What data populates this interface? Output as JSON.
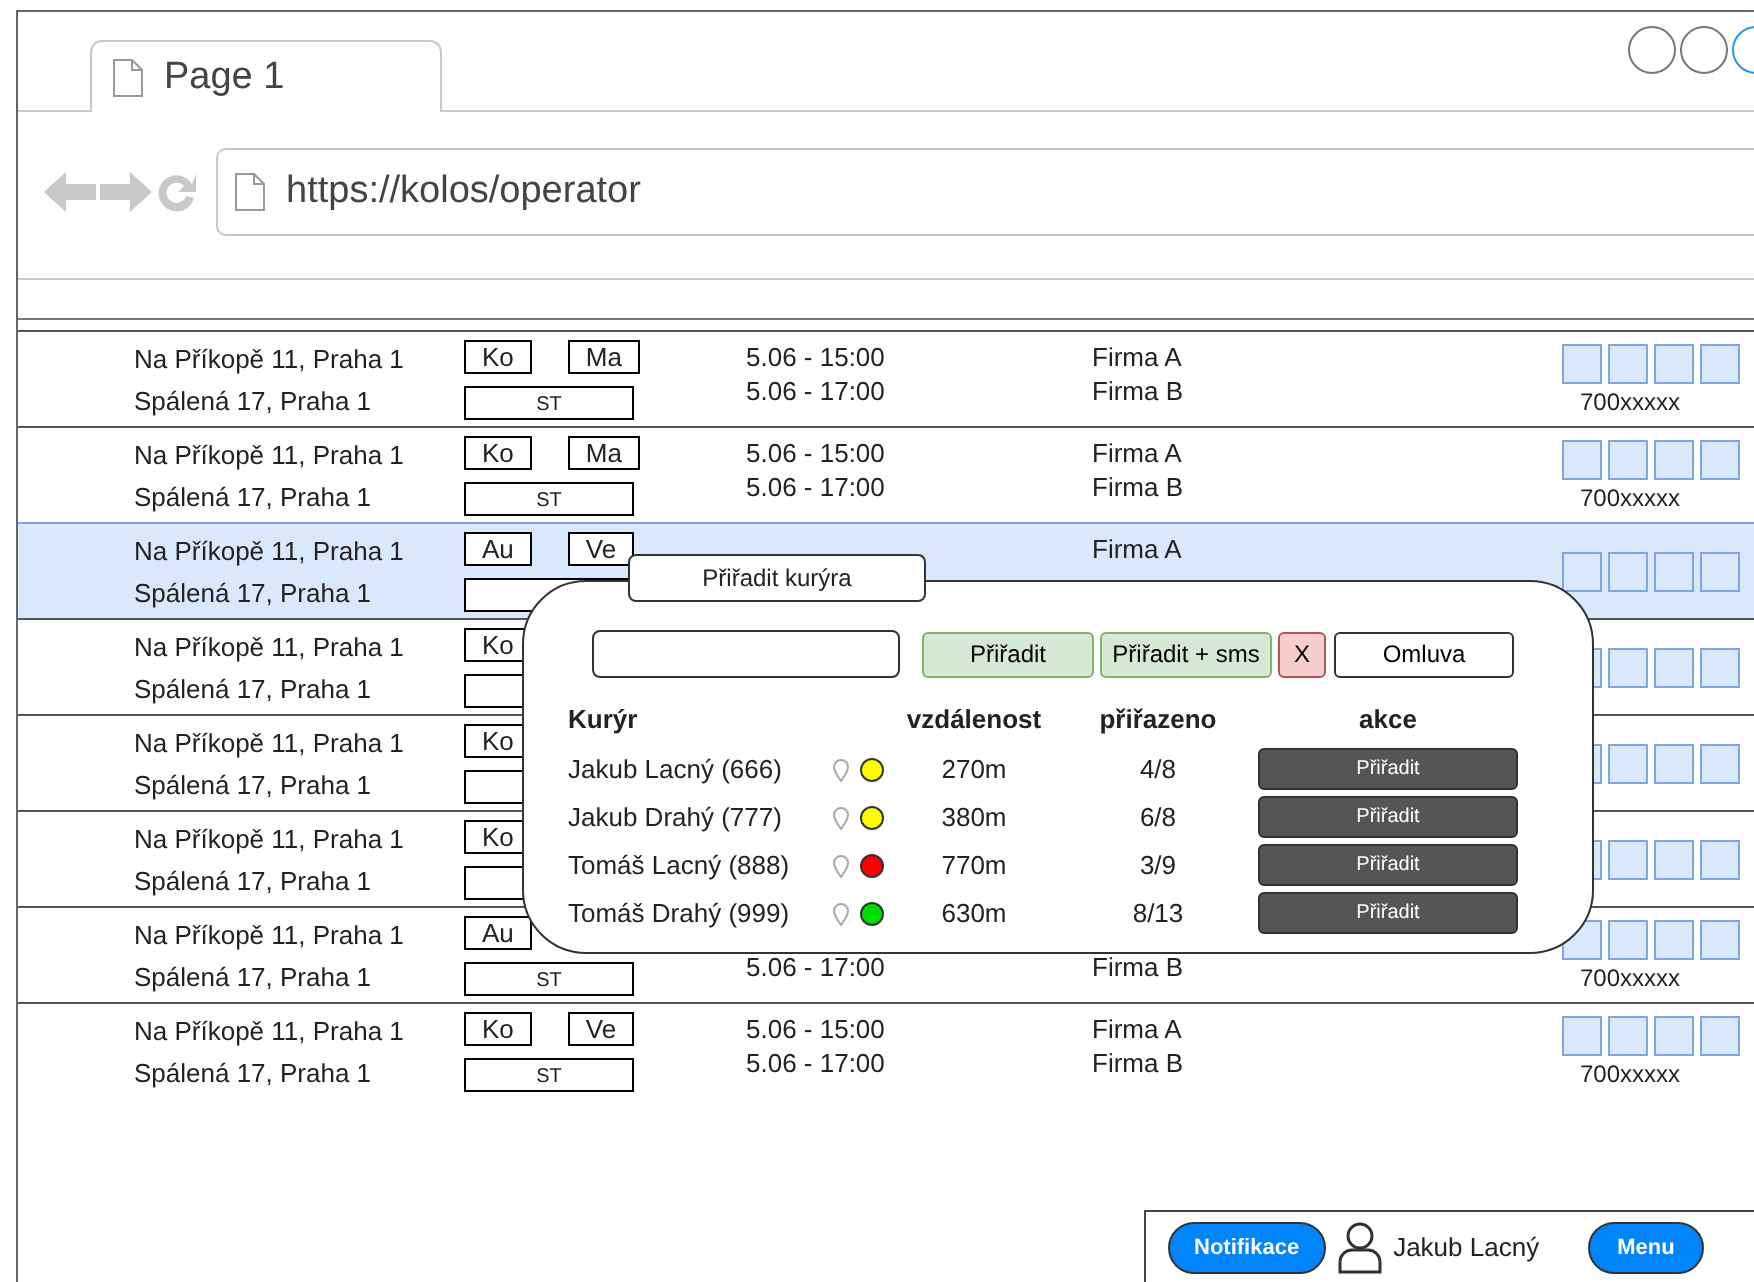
{
  "browser": {
    "tab": "Page 1",
    "url": "https://kolos/operator"
  },
  "orders": [
    {
      "selected": false,
      "pickup": "Na Příkopě 11, Praha 1",
      "dropoff": "Spálená 17, Praha 1",
      "tags": [
        "Ko",
        "Ma"
      ],
      "type": "ST",
      "time_from": "5.06 - 15:00",
      "time_to": "5.06 - 17:00",
      "company_from": "Firma A",
      "company_to": "Firma B",
      "phone": "700xxxxx"
    },
    {
      "selected": false,
      "pickup": "Na Příkopě 11, Praha 1",
      "dropoff": "Spálená 17, Praha 1",
      "tags": [
        "Ko",
        "Ma"
      ],
      "type": "ST",
      "time_from": "5.06 - 15:00",
      "time_to": "5.06 - 17:00",
      "company_from": "Firma A",
      "company_to": "Firma B",
      "phone": "700xxxxx"
    },
    {
      "selected": true,
      "pickup": "Na Příkopě 11, Praha 1",
      "dropoff": "Spálená 17, Praha 1",
      "tags": [
        "Au",
        "Ve"
      ],
      "company_from": "Firma A"
    },
    {
      "selected": false,
      "pickup": "Na Příkopě 11, Praha 1",
      "dropoff": "Spálená 17, Praha 1",
      "tags": [
        "Ko"
      ]
    },
    {
      "selected": false,
      "pickup": "Na Příkopě 11, Praha 1",
      "dropoff": "Spálená 17, Praha 1",
      "tags": [
        "Ko"
      ]
    },
    {
      "selected": false,
      "pickup": "Na Příkopě 11, Praha 1",
      "dropoff": "Spálená 17, Praha 1",
      "tags": [
        "Ko"
      ]
    },
    {
      "selected": false,
      "pickup": "Na Příkopě 11, Praha 1",
      "dropoff": "Spálená 17, Praha 1",
      "tags": [
        "Au"
      ],
      "type": "ST",
      "time_to": "5.06 - 17:00",
      "company_to": "Firma B",
      "phone": "700xxxxx"
    },
    {
      "selected": false,
      "pickup": "Na Příkopě 11, Praha 1",
      "dropoff": "Spálená 17, Praha 1",
      "tags": [
        "Ko",
        "Ve"
      ],
      "type": "ST",
      "time_from": "5.06 - 15:00",
      "time_to": "5.06 - 17:00",
      "company_from": "Firma A",
      "company_to": "Firma B",
      "phone": "700xxxxx"
    }
  ],
  "popup": {
    "title": "Přiřadit kurýra",
    "buttons": [
      {
        "label": "Přiřadit",
        "kind": "assign"
      },
      {
        "label": "Přiřadit + sms",
        "kind": "assign"
      },
      {
        "label": "X",
        "kind": "cancel"
      },
      {
        "label": "Omluva",
        "kind": "plain"
      }
    ],
    "columns": [
      "Kurýr",
      "vzdálenost",
      "přiřazeno",
      "akce"
    ],
    "couriers": [
      {
        "name": "Jakub Lacný (666)",
        "color": "#ffff00",
        "distance": "270m",
        "assigned": "4/8",
        "action": "Přiřadit"
      },
      {
        "name": "Jakub Drahý (777)",
        "color": "#ffff00",
        "distance": "380m",
        "assigned": "6/8",
        "action": "Přiřadit"
      },
      {
        "name": "Tomáš Lacný (888)",
        "color": "#ff0000",
        "distance": "770m",
        "assigned": "3/9",
        "action": "Přiřadit"
      },
      {
        "name": "Tomáš Drahý (999)",
        "color": "#00dd00",
        "distance": "630m",
        "assigned": "8/13",
        "action": "Přiřadit"
      }
    ]
  },
  "footer": {
    "notifications": "Notifikace",
    "user": "Jakub Lacný",
    "menu": "Menu"
  }
}
